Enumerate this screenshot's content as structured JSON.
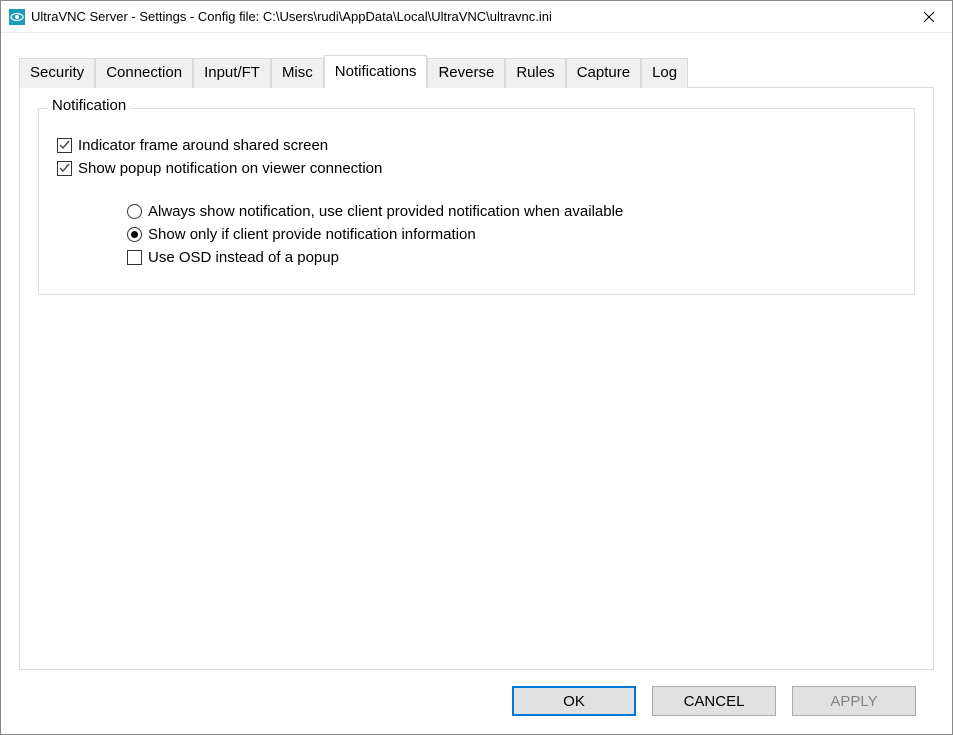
{
  "window": {
    "title": "UltraVNC Server - Settings - Config file: C:\\Users\\rudi\\AppData\\Local\\UltraVNC\\ultravnc.ini"
  },
  "tabs": {
    "security": "Security",
    "connection": "Connection",
    "inputft": "Input/FT",
    "misc": "Misc",
    "notifications": "Notifications",
    "reverse": "Reverse",
    "rules": "Rules",
    "capture": "Capture",
    "log": "Log"
  },
  "group": {
    "title": "Notification",
    "indicator_frame": "Indicator frame around shared screen",
    "show_popup": "Show popup notification on viewer connection",
    "radio_always": "Always show notification, use client provided notification when available",
    "radio_only_client": "Show only if client provide notification information",
    "use_osd": "Use OSD instead of a popup"
  },
  "buttons": {
    "ok": "OK",
    "cancel": "CANCEL",
    "apply": "APPLY"
  }
}
